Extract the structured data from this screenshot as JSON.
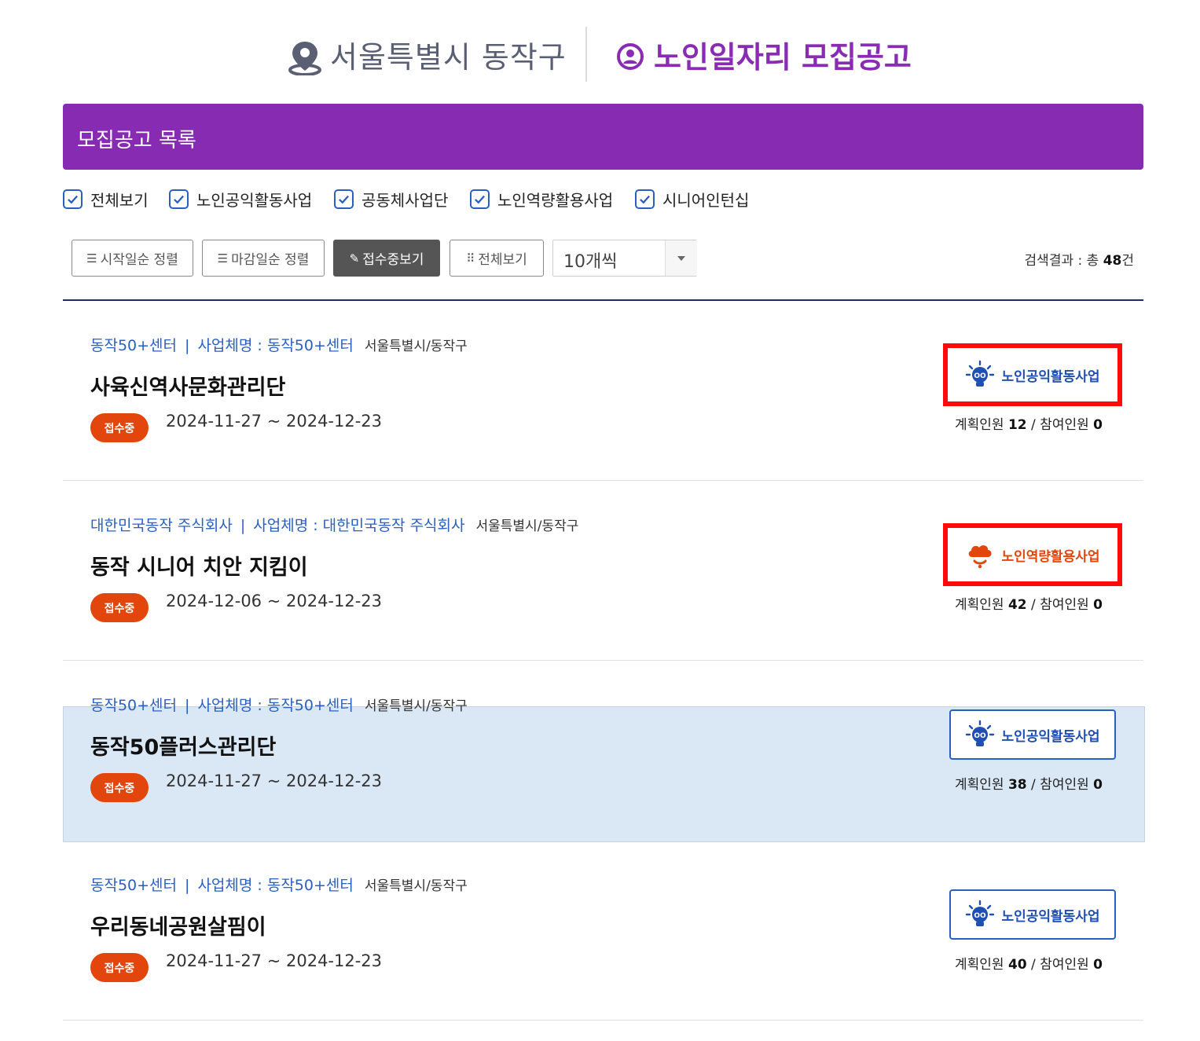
{
  "header": {
    "location": "서울특별시 동작구",
    "title": "노인일자리 모집공고"
  },
  "section": {
    "title": "모집공고 목록"
  },
  "filters": [
    {
      "label": "전체보기",
      "checked": true
    },
    {
      "label": "노인공익활동사업",
      "checked": true
    },
    {
      "label": "공동체사업단",
      "checked": true
    },
    {
      "label": "노인역량활용사업",
      "checked": true
    },
    {
      "label": "시니어인턴십",
      "checked": true
    }
  ],
  "toolbar": {
    "sort_start": "시작일순 정렬",
    "sort_end": "마감일순 정렬",
    "open_only": "접수중보기",
    "view_all": "전체보기",
    "page_size": "10개씩",
    "result_prefix": "검색결과 : 총 ",
    "result_count": "48",
    "result_suffix": "건"
  },
  "labels": {
    "org_prefix": "사업체명 : ",
    "planned": "계획인원 ",
    "participants": "참여인원 ",
    "slash": " / "
  },
  "jobs": [
    {
      "center": "동작50+센터",
      "org": "동작50+센터",
      "region": "서울특별시/동작구",
      "title": "사육신역사문화관리단",
      "status": "접수중",
      "period": "2024-11-27 ~ 2024-12-23",
      "type": "노인공익활동사업",
      "planned": "12",
      "participants": "0"
    },
    {
      "center": "대한민국동작 주식회사",
      "org": "대한민국동작 주식회사",
      "region": "서울특별시/동작구",
      "title": "동작 시니어 치안 지킴이",
      "status": "접수중",
      "period": "2024-12-06 ~ 2024-12-23",
      "type": "노인역량활용사업",
      "planned": "42",
      "participants": "0"
    },
    {
      "center": "동작50+센터",
      "org": "동작50+센터",
      "region": "서울특별시/동작구",
      "title": "동작50플러스관리단",
      "status": "접수중",
      "period": "2024-11-27 ~ 2024-12-23",
      "type": "노인공익활동사업",
      "planned": "38",
      "participants": "0"
    },
    {
      "center": "동작50+센터",
      "org": "동작50+센터",
      "region": "서울특별시/동작구",
      "title": "우리동네공원살핌이",
      "status": "접수중",
      "period": "2024-11-27 ~ 2024-12-23",
      "type": "노인공익활동사업",
      "planned": "40",
      "participants": "0"
    }
  ],
  "colors": {
    "brand_purple": "#872bb2",
    "link_blue": "#2a5fc2",
    "status_orange": "#e2460c",
    "highlight_row": "#dae7f5",
    "annotation_red": "#ff0a0a"
  },
  "icons": {
    "location": "map-pin-icon",
    "job": "person-circle-icon",
    "checkbox": "check-icon",
    "public_type": "lightbulb-icon",
    "capacity_type": "cloud-icon",
    "dropdown": "caret-down-icon"
  }
}
